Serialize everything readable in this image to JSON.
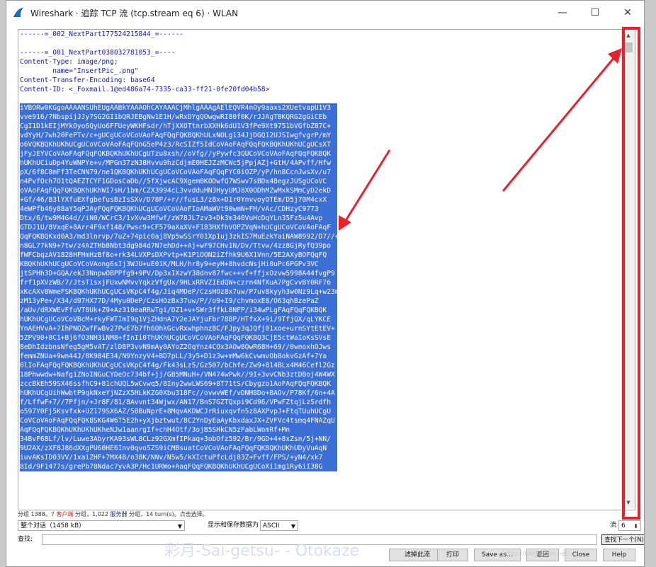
{
  "window": {
    "title": "Wireshark · 追踪 TCP 流 (tcp.stream eq 6) · WLAN",
    "controls": {
      "minimize": "—",
      "maximize": "☐",
      "close": "✕"
    }
  },
  "stream": {
    "header_lines": [
      "------=_002_NextPart177524215844_=------",
      "",
      "------=_001_NextPart038032781053_=----",
      "Content-Type: image/png;",
      "        name=\"InsertPic_.png\"",
      "Content-Transfer-Encoding: base64",
      "Content-ID: <_Foxmail.1@ed486a74-7335-ca33-ff21-0fe20fd04b58>",
      ""
    ],
    "base64_lines": [
      "iVBORw0KGgoAAAANSUhEUgAABkYAAAOhCAYAAACjMhlgAAAgAElEQVR4nOy9aaxs2XUetvapU1V3",
      "vve916/7NbspijJJy7SG2GI1bQRJEBgNw1E1H/wRxDYgQOwgwRI80f0K/rJJAgTBKQRG2gGiCEb",
      "CgI1D1kEIjMYkOyo6QyUo6FFUeyWKHFsdr/hTjXXOTtnrbXXHk6dU1V3fPe9Xt9751bVGfbZ87C+",
      "vdYyH/7wh20FePTv/c+gUCgUCoVCoVAoFAqFQqFQKBQKhULxNOLg134JjDGQ12UJSIwgfvgrP/mY",
      "o6VQKBQKhUKhUCgUCoVCoVAoFAqFQnG5eP4z3/RcSIZf5IdCoVAoFAqFQqFQKBQKhUKhUCgUCsXT",
      "jFyJEYVCoVAoFAqFQqFQKBQKhUKhUCgUTzu8xsh//oVfg//yPywfc3QUCoVCoVAoFAqFQqFQKBQK",
      "hUKhUCiuDp4YuWNPYe+v/MPGm37zN38Hvvu9hzCdjmE0HEJZzMCWc5jPpjAZj+GtH/4APvff/Hfw",
      "pX/6f8C8mFf3TeCNN79/ne1QKBQKhUKhUCgUCoVCoVAoFAqFQqFYC0iOZP/yP/hn8CcnJwsXv/u7",
      "n4PvfOch7O1tQAEZTCYF1GDosCaDb//5fXjwcAC9Xgem0KODwfQ7WSwv7sBDx48egzJUSgUCoVC",
      "oVAoFAqFQqFQKBQKhUKhWI7sH/1bm/CZX3994cL3vvdduHN3HyyUMJ8X0ODhMZwMxkSMmCyD2ekD",
      "+Gf/46/B3lYXfuEXfgbefusBzIsSXv/D78P/+r//fusL3/z8x+D1r0YnvvoyOTEm/D5j70M4cxX",
      "4eWPfb46y88aY5qPJAyFQqFQKBQKhUCgUCoVCoVAoFIoAMaWVt90wmN+FH/vAc/CDHzyC9773",
      "Dtx/6/tw9M4G4d//iN0/WCrC3/1vXvw3Mfwf/zW78JL7zv3+Dk3m340VuHcDqYLn35Fz5u4Avp",
      "GTDJ1U/8VxqE+8Arr4F9xf148/Pwsc9+CF579aXaXV+F183HXfhVOPZVqN+hUCgUCoVCoVAoFAqF",
      "QqFQKBQKxd0A3/md3lnrvp/7uZ+74pic0aj8Vp5wSSrY01Xp1uj3zkIS7MuEzkYaiNAW8992/D7//+",
      "n8GL77kN9+7tw/z4AZTHb8Nbt3dg984d7N7ehDd++Aj+wF97CHv1N/Dv/Ttvw/4zz8GjRyfQ39po",
      "fWFCbqzAV1828HFHmHzBf8o+rk34LVXPsDXPvtp+K1P1OON2iZfhk9U6X1Vnn/5E2AXyBOFQqFQ",
      "KBQKhUKhUCgUCoVCoVAong6sIj3WJU+uE01K/MLH/hr8y9+eyH+8hvdcNsjHi0uPc6PGPv3VC",
      "jtSPHh3D+GQA/ekJ3NnpwOBPPfg9+9PV/Dp3xIXzwY38dnv87fwc++vf+ffjxOzvw5998A44fvgP9",
      "frf1pXVzWB/7/JtsT1sxjFUxwNMvvYqkzVfgUx/9HLxRRVZIEdQW+czrn4NfXuA7PgCvvBY0RF76",
      "xKcAXv8WmeFSKBQKhUKhUCgUCsVKpC4f4g/Jiq4MOeP/CzsHOz8x7uw/P7uv8kyyh3w0Nz9Lq+w23ma",
      "zM13yPe+/X34/d97HX77D/4Myu0DeP/CzsHOzBx37uw/P//o9+I9/chvmoxE8/O63qhBzePaZ",
      "/aUv/dRXWEvFfuVT8Uk+Z9+Az310eaRRwTgi/DZ1+v+SWr3ffkL8NFP/i34wPLgFAqFQqFQKBQK",
      "hUKhUCgUCoVCoVBcM+rkyFWTImI9q1VjZHdnA7Y2eJAYjuFbr78BP/HTfxX+9i/9TfjQX/qLYKCE",
      "YnAEHVvA+7IhPNOZwfFwBv27PwE7b7fh6OhkGcvRxwhphnz8C/FJpy3qJQfj01xoe+urnSYtEtEV+",
      "5ZPV90+8C1+Bj6fO3NH3iNM8+fInIi0ThUKhUCgUCoVCoVAoFAqFQqFQKBQ3CjE5ctWaIoKsSVsE",
      "8eDhIdzbnsNfeg5gM5vAT/zlD8P3vvN9mAy0AYoZ2OqYnz4COx3AOw8OwR68H+69//0wnoxhOJws",
      "femmZNUa+9wn44J/BK984E34/N9YnzyV4+BD7pLL/3y5+D1z3w+mMw6kCvwmvOb8okvGzAf+7Ya",
      "0lIoFAqFQqFQKBQKhUKhUCgUCsVKpC4f4g/Fk43sLz5/Gz507/bChfe/Zw9+814BLx4M46Cefl2Gz",
      "18Phwwdw+Nafg1ZNoINGuCYDeOc734bf+jj/GB5MNuH+/VN474wPwk//9I+3vvCNb3ztDBoj4W4WX",
      "zccBkEh59SX46ssfhC9+81chUQL5wCvwq5/8Iny2wwLWS69+8T71tS/Cbygzo1AoFAqFQqFQKBQK",
      "hUKhUCgUihWwbtP9qkNxeYjNZzX5HLkKZG0Xbu318Fc//ovwvWEf/vDNH8Do+BAOv/P78Kf/6n+4A",
      "f/LffwF+7//7Pfjn/+Jr8F/81/8Avvnt34Wjwx/AN17/BnS7GZTQxpi9Cd96/VPwFZtqjLz5rdfh",
      "o597Y0Fj5Ksvfxk+UZ179SX6AZ/58BuNprE+8MqvAKDWCJrRiuxqvfn5z8AXPvpJ+FtqTUuhUCgU",
      "CoVCoVAoFAqFQqFQKBSKG4W6T5E2h+yXjbztwut/8C2YnDyEaAyKbxdaxJX+ZVFVc4tsmq4FNAZqU",
      "AqFQqFQKBQKhUKhUKhUKheNJw1aanrgIf+chH4Otf/3ojB5SHkCN5zFabLWomRf+Mn",
      "34BvF68Lf/lv/Luwe3AbyrKA93sWL8CLz92GXmfIPkaq+3obOfz592/Br/9GD+4+8xZsn/5j+NN/",
      "9U2AX/zXF8J86dXXgPU60HE6Inv0qvo5ZS9iCMBsuatCoVCoVAoFAqFQqFQKBQKhUKhUDyVuAqN",
      "iuvAKsID03VV/1xaiZHF+7MX4B/o38K/NNv/N5w5/kXIctuPfcLdj83Z+Fvff/FPS/+yN4/xk7",
      "8Id/9F1477s/grePb78Ndac7yvA3P/Hc1URWo+AaqFQqFQKBQKhUKhUCgUCoXi1mg1Ry6iI38G"
    ]
  },
  "status_text": {
    "part1": "分组 1388。",
    "part2": "7 客户端",
    "part3": " 分组，1,022 ",
    "part4": "服务器",
    "part5": " 分组，14 turn(s)。点击选择。"
  },
  "controls": {
    "conversation_select": "整个对话（1458 kB）",
    "show_as_label": "显示和保存数据为",
    "format_select": "ASCII",
    "stream_label": "流",
    "stream_value": "6",
    "find_label": "查找:",
    "find_value": "",
    "find_next_button": "查找下一个(N)"
  },
  "buttons": {
    "filter_out": "滤掉此流",
    "print": "打印",
    "save_as": "Save as…",
    "back": "返回",
    "close": "Close",
    "help": "Help"
  },
  "watermark": "彩月-Sai-getsu- - Otokaze",
  "watermark_url": "https://blog.csdn.net/...",
  "colors": {
    "highlight": "#3b6fd6",
    "header_text": "#1a1aa6",
    "annotation_red": "#e8212c"
  }
}
